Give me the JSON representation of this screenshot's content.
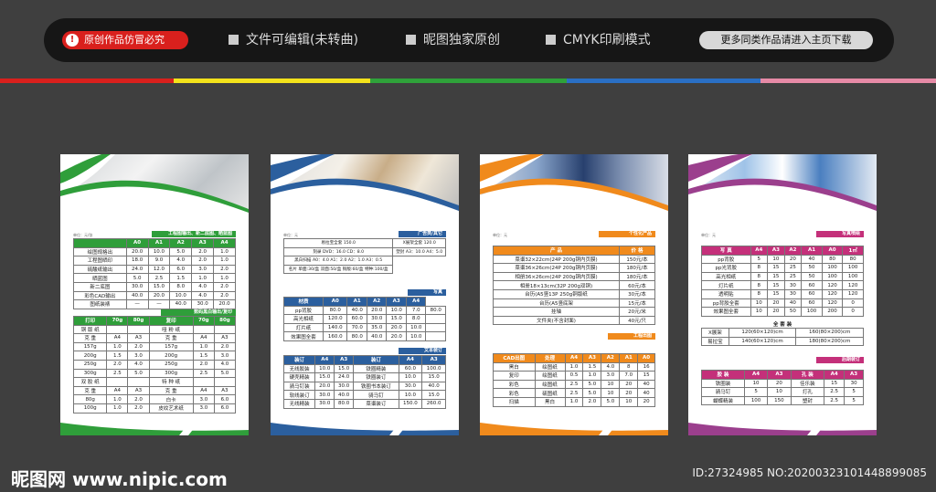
{
  "header": {
    "warning": "原创作品仿冒必究",
    "features": [
      "文件可编辑(未转曲)",
      "昵图独家原创",
      "CMYK印刷模式"
    ],
    "cta": "更多同类作品请进入主页下载"
  },
  "colors": {
    "stripes": [
      "#d9201d",
      "#f3e21b",
      "#2fa23a",
      "#2a6fc4",
      "#1a4a9a",
      "#e68aa6"
    ]
  },
  "footer": {
    "logo": "昵图网 www.nipic.com",
    "id": "ID:27324985 NO:20200323101448899085"
  },
  "panels": [
    {
      "unit": "单位：元/张",
      "section1": "工程图输出、新二底图、晒蓝图",
      "t1_head": [
        "",
        "A0",
        "A1",
        "A2",
        "A3",
        "A4"
      ],
      "t1": [
        [
          "绘图规格出",
          "20.0",
          "10.0",
          "5.0",
          "2.0",
          "1.0"
        ],
        [
          "工程图晒印",
          "18.0",
          "9.0",
          "4.0",
          "2.0",
          "1.0"
        ],
        [
          "硫酸纸输出",
          "24.0",
          "12.0",
          "6.0",
          "3.0",
          "2.0"
        ],
        [
          "晒蓝图",
          "5.0",
          "2.5",
          "1.5",
          "1.0",
          "1.0"
        ],
        [
          "新二底图",
          "30.0",
          "15.0",
          "8.0",
          "4.0",
          "2.0"
        ],
        [
          "彩色CAD输出",
          "40.0",
          "20.0",
          "10.0",
          "4.0",
          "2.0"
        ],
        [
          "图纸装裱",
          "—",
          "—",
          "40.0",
          "30.0",
          "20.0"
        ]
      ],
      "section2": "数码黑白输出/复印",
      "t2_head": [
        "打印",
        "70g",
        "80g",
        "复印",
        "70g",
        "80g"
      ],
      "t2": [
        [
          "铜 版 纸",
          "",
          "",
          "哑 粉 纸",
          "",
          ""
        ],
        [
          "克 重",
          "A4",
          "A3",
          "克 重",
          "A4",
          "A3"
        ],
        [
          "157g",
          "1.0",
          "2.0",
          "157g",
          "1.0",
          "2.0"
        ],
        [
          "200g",
          "1.5",
          "3.0",
          "200g",
          "1.5",
          "3.0"
        ],
        [
          "250g",
          "2.0",
          "4.0",
          "250g",
          "2.0",
          "4.0"
        ],
        [
          "300g",
          "2.5",
          "5.0",
          "300g",
          "2.5",
          "5.0"
        ],
        [
          "双 胶 纸",
          "",
          "",
          "特 种 纸",
          "",
          ""
        ],
        [
          "克 重",
          "A4",
          "A3",
          "克 重",
          "A4",
          "A3"
        ],
        [
          "80g",
          "1.0",
          "2.0",
          "白卡",
          "3.0",
          "6.0"
        ],
        [
          "100g",
          "1.0",
          "2.0",
          "皮纹艺术纸",
          "3.0",
          "6.0"
        ]
      ]
    },
    {
      "unit": "单位：元",
      "section1": "广告类/其它",
      "t1": [
        [
          "易拉宝全套 150.0",
          "X展架全套 120.0"
        ],
        [
          "刻录 DVD：16.0 CD：8.0",
          "塑封 A3：10.0 A4：5.0"
        ],
        [
          "黑白扫描 A0：4.0 A1：2.0 A2：1.0 A3：0.5"
        ],
        [
          "名片 单面:30/盒 双面:50/盒 铜版:60/盒 特种:100/盒"
        ]
      ],
      "section2": "写真",
      "t2_head": [
        "材质",
        "A0",
        "A1",
        "A2",
        "A3",
        "A4"
      ],
      "t2": [
        [
          "pp背胶",
          "80.0",
          "40.0",
          "20.0",
          "10.0",
          "7.0",
          "80.0"
        ],
        [
          "高光相纸",
          "120.0",
          "60.0",
          "30.0",
          "15.0",
          "8.0",
          ""
        ],
        [
          "灯片纸",
          "140.0",
          "70.0",
          "35.0",
          "20.0",
          "10.0",
          ""
        ],
        [
          "效果图全套",
          "160.0",
          "80.0",
          "40.0",
          "20.0",
          "10.0",
          ""
        ]
      ],
      "section3": "文本装订",
      "t3_head": [
        "装订",
        "A4",
        "A3",
        "装订",
        "A4",
        "A3"
      ],
      "t3": [
        [
          "无线胶装",
          "10.0",
          "15.0",
          "铁圈精装",
          "60.0",
          "100.0"
        ],
        [
          "硬壳精装",
          "15.0",
          "24.0",
          "铁圈装订",
          "10.0",
          "15.0"
        ],
        [
          "骑马钉装",
          "20.0",
          "30.0",
          "铁圈书本装订",
          "30.0",
          "40.0"
        ],
        [
          "软线装订",
          "30.0",
          "40.0",
          "骑马钉",
          "10.0",
          "15.0"
        ],
        [
          "无线精装",
          "30.0",
          "80.0",
          "菜谱装订",
          "150.0",
          "260.0"
        ]
      ]
    },
    {
      "unit": "单位：元",
      "section1": "个性化产品",
      "t1_head": [
        "产 品",
        "价 格"
      ],
      "t1": [
        [
          "菜谱32×22cm(24P 200g铜内页膜)",
          "150元/本"
        ],
        [
          "菜谱36×26cm(24P 200g铜内页膜)",
          "180元/本"
        ],
        [
          "相册36×26cm(24P 200g铜内页膜)",
          "180元/本"
        ],
        [
          "相册18×13cm(32P 200g双铜)",
          "60元/本"
        ],
        [
          "台历(A5竖13P 250g铜版纸",
          "30元/本"
        ],
        [
          "台历(A5竖底架",
          "15元/本"
        ],
        [
          "挂轴",
          "20元/米"
        ],
        [
          "文件夹(不含封面)",
          "40元/只"
        ]
      ],
      "section2": "工程出图",
      "t2_head": [
        "CAD出图",
        "处理",
        "A4",
        "A3",
        "A2",
        "A1",
        "A0"
      ],
      "t2": [
        [
          "黑白",
          "绘图纸",
          "1.0",
          "1.5",
          "4.0",
          "8",
          "16"
        ],
        [
          "复印",
          "绘图纸",
          "0.5",
          "1.0",
          "3.0",
          "7.0",
          "15"
        ],
        [
          "彩色",
          "绘图纸",
          "2.5",
          "5.0",
          "10",
          "20",
          "40"
        ],
        [
          "彩色",
          "硫图纸",
          "2.5",
          "5.0",
          "10",
          "20",
          "40"
        ],
        [
          "扫描",
          "黑白",
          "1.0",
          "2.0",
          "5.0",
          "10",
          "20"
        ]
      ]
    },
    {
      "unit": "单位：元",
      "section1": "写真喷绘",
      "t1_head": [
        "写 真",
        "A4",
        "A3",
        "A2",
        "A1",
        "A0",
        "1㎡"
      ],
      "t1": [
        [
          "pp背胶",
          "5",
          "10",
          "20",
          "40",
          "80",
          "80"
        ],
        [
          "pp光背胶",
          "8",
          "15",
          "25",
          "50",
          "100",
          "100"
        ],
        [
          "高光相纸",
          "8",
          "15",
          "25",
          "50",
          "100",
          "100"
        ],
        [
          "灯片纸",
          "8",
          "15",
          "30",
          "60",
          "120",
          "120"
        ],
        [
          "透明贴",
          "8",
          "15",
          "30",
          "60",
          "120",
          "120"
        ],
        [
          "pp背胶全套",
          "10",
          "20",
          "40",
          "60",
          "120",
          "0"
        ],
        [
          "效果图全套",
          "10",
          "20",
          "50",
          "100",
          "200",
          "0"
        ]
      ],
      "section1b": "全 套 装",
      "t1b": [
        [
          "X展架",
          "120(60×120)cm",
          "160(80×200)cm"
        ],
        [
          "易拉宝",
          "140(60×120)cm",
          "180(80×200)cm"
        ]
      ],
      "section2": "后期装订",
      "t2_head": [
        "胶 装",
        "A4",
        "A3",
        "孔 装",
        "A4",
        "A3"
      ],
      "t2": [
        [
          "铁圈装",
          "10",
          "20",
          "佳乐装",
          "15",
          "30"
        ],
        [
          "骑马钉",
          "5",
          "10",
          "打孔",
          "2.5",
          "5"
        ],
        [
          "蝴蝶精装",
          "100",
          "150",
          "塑封",
          "2.5",
          "5"
        ]
      ]
    }
  ]
}
